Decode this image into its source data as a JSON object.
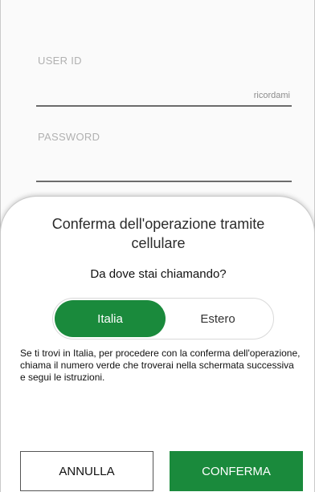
{
  "login": {
    "user_id_label": "USER ID",
    "remember_label": "ricordami",
    "password_label": "PASSWORD"
  },
  "sheet": {
    "title_line1": "Conferma dell'operazione tramite",
    "title_line2": "cellulare",
    "question": "Da dove stai chiamando?",
    "segments": [
      {
        "label": "Italia",
        "selected": true
      },
      {
        "label": "Estero",
        "selected": false
      }
    ],
    "info": "Se ti trovi in Italia, per procedere con la conferma dell'operazione, chiama il numero verde che troverai nella schermata successiva e segui le istruzioni.",
    "cancel_label": "ANNULLA",
    "confirm_label": "CONFERMA"
  },
  "colors": {
    "accent": "#1a8a3c"
  }
}
